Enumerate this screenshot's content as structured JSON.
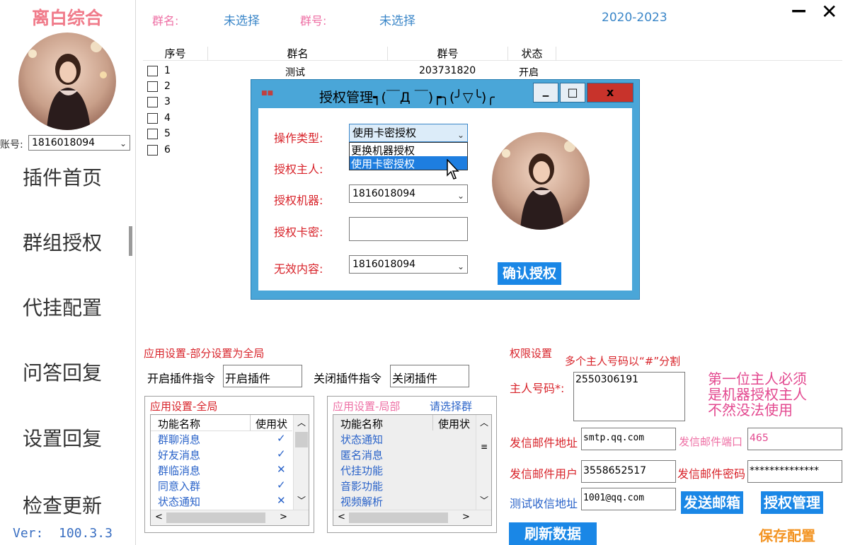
{
  "app": {
    "title": "离白综合",
    "version_label": "Ver:",
    "version": "100.3.3"
  },
  "account": {
    "label": "账号:",
    "value": "1816018094"
  },
  "nav": [
    "插件首页",
    "群组授权",
    "代挂配置",
    "问答回复",
    "设置回复",
    "检查更新"
  ],
  "header": {
    "group_name_label": "群名:",
    "group_name_value": "未选择",
    "group_id_label": "群号:",
    "group_id_value": "未选择",
    "years": "2020-2023"
  },
  "window": {
    "minimize": "−",
    "close": "✕"
  },
  "grid": {
    "columns": [
      "序号",
      "群名",
      "群号",
      "状态"
    ],
    "rows": [
      {
        "no": "1",
        "name": "测试",
        "id": "203731820",
        "status": "开启"
      },
      {
        "no": "2",
        "name": "",
        "id": "",
        "status": ""
      },
      {
        "no": "3",
        "name": "",
        "id": "",
        "status": ""
      },
      {
        "no": "4",
        "name": "",
        "id": "",
        "status": ""
      },
      {
        "no": "5",
        "name": "",
        "id": "",
        "status": ""
      },
      {
        "no": "6",
        "name": "",
        "id": "",
        "status": ""
      }
    ]
  },
  "settings": {
    "title": "应用设置-部分设置为全局",
    "open_cmd_label": "开启插件指令",
    "open_cmd_value": "开启插件",
    "close_cmd_label": "关闭插件指令",
    "close_cmd_value": "关闭插件",
    "global": {
      "title": "应用设置-全局",
      "col_name": "功能名称",
      "col_use": "使用状",
      "rows": [
        {
          "name": "群聊消息",
          "state": "✓"
        },
        {
          "name": "好友消息",
          "state": "✓"
        },
        {
          "name": "群临消息",
          "state": "✕"
        },
        {
          "name": "同意入群",
          "state": "✓"
        },
        {
          "name": "状态通知",
          "state": "✕"
        }
      ]
    },
    "local": {
      "title": "应用设置-局部",
      "select_hint": "请选择群",
      "col_name": "功能名称",
      "col_use": "使用状",
      "rows": [
        "状态通知",
        "匿名消息",
        "代挂功能",
        "音影功能",
        "视频解析"
      ]
    }
  },
  "perm": {
    "title": "权限设置",
    "hint": "多个主人号码以“#”分割",
    "owner_label": "主人号码*:",
    "owner_value": "2550306191",
    "note": [
      "第一位主人必须",
      "是机器授权主人",
      "不然没法使用"
    ],
    "smtp_label": "发信邮件地址",
    "smtp_value": "smtp.qq.com",
    "port_label": "发信邮件端口",
    "port_value": "465",
    "user_label": "发信邮件用户",
    "user_value": "3558652517",
    "pwd_label": "发信邮件密码",
    "pwd_value": "**************",
    "test_label": "测试收信地址",
    "test_value": "1001@qq.com",
    "send_btn": "发送邮箱",
    "auth_btn": "授权管理",
    "refresh_btn": "刷新数据",
    "save_btn": "保存配置"
  },
  "dialog": {
    "title": "授权管理┑(￣Д ￣)┍╮(╯▽╰)╭",
    "op_label": "操作类型:",
    "op_value": "使用卡密授权",
    "op_options": [
      "更换机器授权",
      "使用卡密授权"
    ],
    "owner_label": "授权主人:",
    "machine_label": "授权机器:",
    "machine_value": "1816018094",
    "card_label": "授权卡密:",
    "invalid_label": "无效内容:",
    "invalid_value": "1816018094",
    "confirm_btn": "确认授权",
    "btn_min": "▁",
    "btn_max": "□",
    "btn_close": "x"
  }
}
